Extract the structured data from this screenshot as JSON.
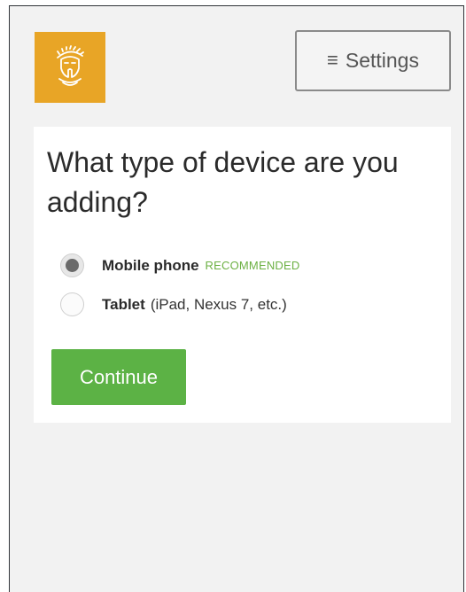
{
  "header": {
    "logo_icon": "spartan-helmet-icon",
    "logo_color": "#e8a526",
    "settings": {
      "icon": "hamburger-menu-icon",
      "icon_glyph": "≡",
      "label": "Settings"
    }
  },
  "device_prompt": {
    "title": "What type of device are you adding?",
    "options": [
      {
        "label": "Mobile phone",
        "badge": "RECOMMENDED",
        "detail": "",
        "selected": true
      },
      {
        "label": "Tablet",
        "badge": "",
        "detail": "(iPad, Nexus 7, etc.)",
        "selected": false
      }
    ],
    "continue_label": "Continue",
    "accent_color": "#5cb245"
  }
}
